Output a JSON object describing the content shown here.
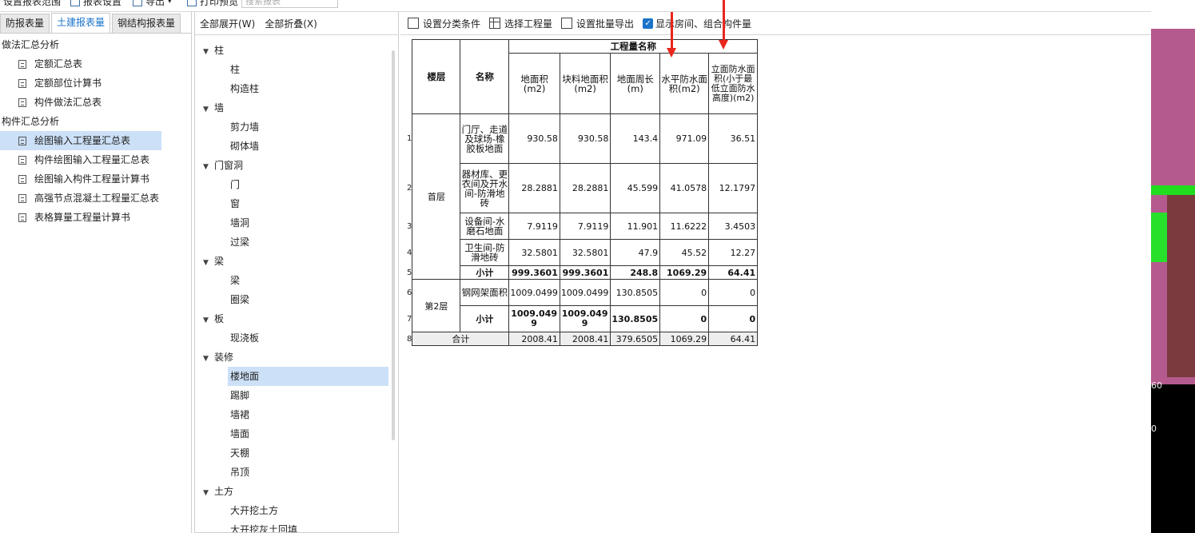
{
  "topbar": {
    "items": [
      {
        "label": "设置报表范围",
        "icon": "report-range-icon"
      },
      {
        "label": "报表设置",
        "icon": "report-settings-icon"
      },
      {
        "label": "导出",
        "icon": "export-icon"
      },
      {
        "label": "打印预览",
        "icon": "print-preview-icon"
      }
    ],
    "search_placeholder": "搜索报表"
  },
  "left": {
    "tabs": [
      {
        "label": "防报表量",
        "active": false
      },
      {
        "label": "土建报表量",
        "active": true
      },
      {
        "label": "钢结构报表量",
        "active": false
      }
    ],
    "groups": [
      {
        "title": "做法汇总分析",
        "items": [
          "定额汇总表",
          "定额部位计算书",
          "构件做法汇总表"
        ]
      },
      {
        "title": "构件汇总分析",
        "items": [
          "绘图输入工程量汇总表",
          "构件绘图输入工程量汇总表",
          "绘图输入构件工程量计算书",
          "高强节点混凝土工程量汇总表",
          "表格算量工程量计算书"
        ]
      }
    ],
    "selected": "绘图输入工程量汇总表"
  },
  "middle": {
    "expand_all": "全部展开(W)",
    "collapse_all": "全部折叠(X)",
    "tree": [
      {
        "label": "柱",
        "children": [
          "柱",
          "构造柱"
        ]
      },
      {
        "label": "墙",
        "children": [
          "剪力墙",
          "砌体墙"
        ]
      },
      {
        "label": "门窗洞",
        "children": [
          "门",
          "窗",
          "墙洞",
          "过梁"
        ]
      },
      {
        "label": "梁",
        "children": [
          "梁",
          "圈梁"
        ]
      },
      {
        "label": "板",
        "children": [
          "现浇板"
        ]
      },
      {
        "label": "装修",
        "children": [
          "楼地面",
          "踢脚",
          "墙裙",
          "墙面",
          "天棚",
          "吊顶"
        ]
      },
      {
        "label": "土方",
        "children": [
          "大开挖土方",
          "大开挖灰土回填"
        ]
      }
    ],
    "selected": "楼地面"
  },
  "right": {
    "toolbar": {
      "set_category": "设置分类条件",
      "select_quantity": "选择工程量",
      "batch_export": "设置批量导出",
      "show_rooms": "显示房间、组合构件量",
      "show_rooms_checked": true
    },
    "table": {
      "group_header": "工程量名称",
      "headers": {
        "floor": "楼层",
        "name": "名称",
        "cols": [
          "地面积(m2)",
          "块料地面积(m2)",
          "地面周长(m)",
          "水平防水面积(m2)",
          "立面防水面积(小于最低立面防水高度)(m2)"
        ]
      },
      "floors": [
        {
          "floor": "首层",
          "rows": [
            {
              "no": "1",
              "name": "门厅、走道及球场-橡胶板地面",
              "values": [
                "930.58",
                "930.58",
                "143.4",
                "971.09",
                "36.51"
              ]
            },
            {
              "no": "2",
              "name": "器材库、更衣间及开水间-防滑地砖",
              "values": [
                "28.2881",
                "28.2881",
                "45.599",
                "41.0578",
                "12.1797"
              ]
            },
            {
              "no": "3",
              "name": "设备间-水磨石地面",
              "values": [
                "7.9119",
                "7.9119",
                "11.901",
                "11.6222",
                "3.4503"
              ]
            },
            {
              "no": "4",
              "name": "卫生间-防滑地砖",
              "values": [
                "32.5801",
                "32.5801",
                "47.9",
                "45.52",
                "12.27"
              ]
            }
          ],
          "subtotal": {
            "no": "5",
            "label": "小计",
            "values": [
              "999.3601",
              "999.3601",
              "248.8",
              "1069.29",
              "64.41"
            ]
          }
        },
        {
          "floor": "第2层",
          "rows": [
            {
              "no": "6",
              "name": "钢网架面积",
              "values": [
                "1009.0499",
                "1009.0499",
                "130.8505",
                "0",
                "0"
              ]
            }
          ],
          "subtotal": {
            "no": "7",
            "label": "小计",
            "values": [
              "1009.0499",
              "1009.0499",
              "130.8505",
              "0",
              "0"
            ]
          }
        }
      ],
      "total": {
        "no": "8",
        "label": "合计",
        "values": [
          "2008.41",
          "2008.41",
          "379.6505",
          "1069.29",
          "64.41"
        ]
      }
    }
  },
  "viewport": {
    "labels": [
      "60",
      "0"
    ]
  },
  "colors": {
    "accent": "#1a73c8",
    "selection": "#cce0f7",
    "annotation_arrow": "#e8261c"
  }
}
